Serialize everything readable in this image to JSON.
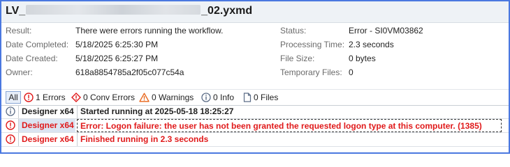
{
  "header": {
    "title_prefix": "LV_",
    "title_suffix": "_02.yxmd"
  },
  "details": {
    "left": [
      {
        "label": "Result:",
        "value": "There were errors running the workflow."
      },
      {
        "label": "Date Completed:",
        "value": "5/18/2025 6:25:30 PM"
      },
      {
        "label": "Date Created:",
        "value": "5/18/2025 6:25:27 PM"
      },
      {
        "label": "Owner:",
        "value": "618a8854785a2f05c077c54a"
      }
    ],
    "right": [
      {
        "label": "Status:",
        "value": "Error - SI0VM03862"
      },
      {
        "label": "Processing Time:",
        "value": "2.3 seconds"
      },
      {
        "label": "File Size:",
        "value": "0 bytes"
      },
      {
        "label": "Temporary Files:",
        "value": "0"
      }
    ]
  },
  "filters": {
    "all": "All",
    "errors": "1 Errors",
    "conv_errors": "0 Conv Errors",
    "warnings": "0 Warnings",
    "info": "0 Info",
    "files": "0 Files"
  },
  "log": [
    {
      "type": "info",
      "source": "Designer x64",
      "message": "Started running at 2025-05-18 18:25:27"
    },
    {
      "type": "error",
      "source": "Designer x64",
      "message": "Error: Logon failure: the user has not been granted the requested logon type at this computer. (1385)"
    },
    {
      "type": "error",
      "source": "Designer x64",
      "message": "Finished running in 2.3 seconds"
    }
  ],
  "colors": {
    "error": "#e0191a",
    "accent_border": "#4a78e0",
    "warning": "#e8661a"
  }
}
